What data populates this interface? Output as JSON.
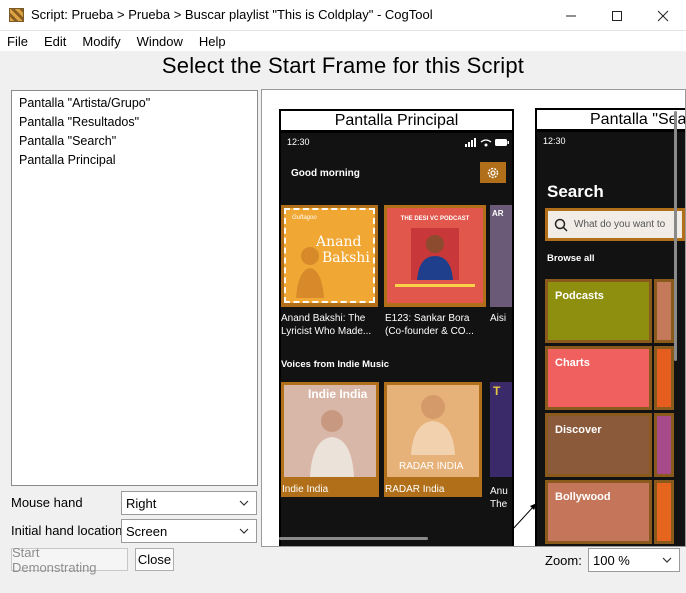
{
  "window": {
    "title": "Script: Prueba > Prueba > Buscar playlist \"This is Coldplay\" - CogTool"
  },
  "menu": [
    "File",
    "Edit",
    "Modify",
    "Window",
    "Help"
  ],
  "heading": "Select the Start Frame for this Script",
  "frames_list": [
    "Pantalla \"Artista/Grupo\"",
    "Pantalla \"Resultados\"",
    "Pantalla \"Search\"",
    "Pantalla Principal"
  ],
  "mouse_hand": {
    "label": "Mouse hand",
    "value": "Right"
  },
  "initial_hand": {
    "label": "Initial hand location",
    "value": "Screen"
  },
  "buttons": {
    "start": "Start Demonstrating",
    "close": "Close"
  },
  "zoom": {
    "label": "Zoom:",
    "value": "100 %"
  },
  "frame1": {
    "title": "Pantalla Principal",
    "time": "12:30",
    "greeting": "Good morning",
    "cards": [
      {
        "art_top": "Anand",
        "art_bottom": "Bakshi",
        "brand": "Guftagoo",
        "caption": "Anand Bakshi: The Lyricist Who Made..."
      },
      {
        "art_top": "THE DESI VC PODCAST",
        "caption": "E123: Sankar Bora (Co-founder & CO..."
      },
      {
        "art_top": "AR",
        "caption": "Aisi"
      }
    ],
    "section2": "Voices from Indie Music",
    "cards2": [
      {
        "art": "Indie India",
        "caption": "Indie India"
      },
      {
        "art": "RADAR INDIA",
        "caption": "RADAR India"
      },
      {
        "art": "T",
        "caption": "Anu The"
      }
    ]
  },
  "frame2": {
    "title": "Pantalla \"Search\"",
    "time": "12:30",
    "heading": "Search",
    "search_placeholder": "What do you want to",
    "browse": "Browse all",
    "genres": [
      {
        "name": "Podcasts",
        "color": "#8e8f0e"
      },
      {
        "name": "Charts",
        "color": "#f0605e"
      },
      {
        "name": "Discover",
        "color": "#8b5a3a"
      },
      {
        "name": "Bollywood",
        "color": "#c5765a"
      }
    ]
  },
  "colors": {
    "overlay": "#b06f18",
    "card_border": "#8a5a1c"
  }
}
